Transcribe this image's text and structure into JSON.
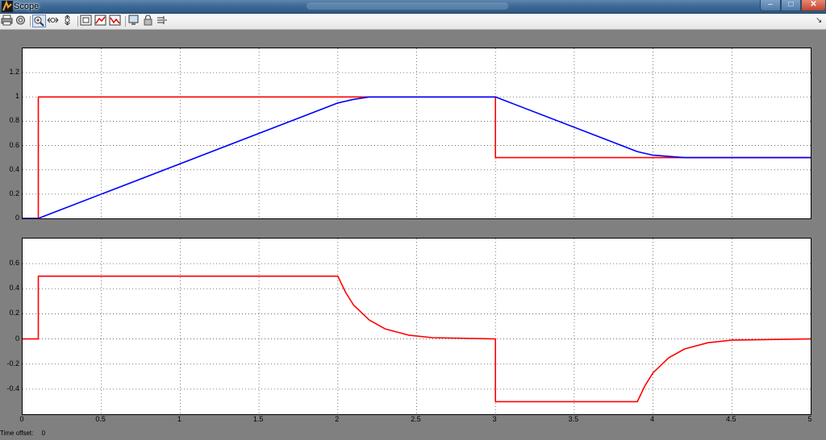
{
  "window": {
    "title": "Scope",
    "min_label": "–",
    "max_label": "□",
    "close_label": "✕"
  },
  "toolbar": {
    "buttons": [
      {
        "name": "print-icon",
        "active": false
      },
      {
        "name": "parameters-icon",
        "active": false
      },
      {
        "name": "zoom-icon",
        "active": true
      },
      {
        "name": "zoom-x-icon",
        "active": false
      },
      {
        "name": "zoom-y-icon",
        "active": false
      },
      {
        "name": "autoscale-icon",
        "active": false
      },
      {
        "name": "save-axes-icon",
        "active": false
      },
      {
        "name": "restore-axes-icon",
        "active": false
      },
      {
        "name": "floating-scope-icon",
        "active": false
      },
      {
        "name": "lock-axes-icon",
        "active": false
      },
      {
        "name": "signal-selection-icon",
        "active": false
      }
    ],
    "more_label": "↘"
  },
  "footer": {
    "time_offset_label": "Time offset:",
    "time_offset_value": "0"
  },
  "colors": {
    "red": "#ff0000",
    "blue": "#0000ff",
    "background": "#808080"
  },
  "chart_data": [
    {
      "type": "line",
      "xlim": [
        0,
        5
      ],
      "ylim": [
        0,
        1.4
      ],
      "yticks": [
        "0",
        "0.2",
        "0.4",
        "0.6",
        "0.8",
        "1",
        "1.2"
      ],
      "xticks": [],
      "grid": true,
      "series": [
        {
          "color": "#ff0000",
          "x": [
            0,
            0.1,
            0.1,
            3.0,
            3.0,
            5.0
          ],
          "y": [
            0,
            0,
            1,
            1,
            0.5,
            0.5
          ]
        },
        {
          "color": "#0000ff",
          "x": [
            0,
            0.1,
            2.0,
            2.1,
            2.2,
            3.0,
            3.9,
            4.0,
            4.2,
            5.0
          ],
          "y": [
            0,
            0,
            0.95,
            0.98,
            1.0,
            1.0,
            0.55,
            0.52,
            0.5,
            0.5
          ]
        }
      ]
    },
    {
      "type": "line",
      "xlim": [
        0,
        5
      ],
      "ylim": [
        -0.6,
        0.8
      ],
      "yticks": [
        "-0.4",
        "-0.2",
        "0",
        "0.2",
        "0.4",
        "0.6"
      ],
      "xticks": [
        "0",
        "0.5",
        "1",
        "1.5",
        "2",
        "2.5",
        "3",
        "3.5",
        "4",
        "4.5",
        "5"
      ],
      "grid": true,
      "series": [
        {
          "color": "#ff0000",
          "x": [
            0,
            0.1,
            0.1,
            2.0,
            2.05,
            2.1,
            2.2,
            2.3,
            2.45,
            2.6,
            3.0,
            3.0,
            3.9,
            3.95,
            4.0,
            4.1,
            4.2,
            4.35,
            4.5,
            5.0
          ],
          "y": [
            0,
            0,
            0.5,
            0.5,
            0.37,
            0.27,
            0.15,
            0.08,
            0.03,
            0.01,
            0,
            -0.5,
            -0.5,
            -0.37,
            -0.27,
            -0.15,
            -0.08,
            -0.03,
            -0.01,
            0
          ]
        }
      ]
    }
  ]
}
